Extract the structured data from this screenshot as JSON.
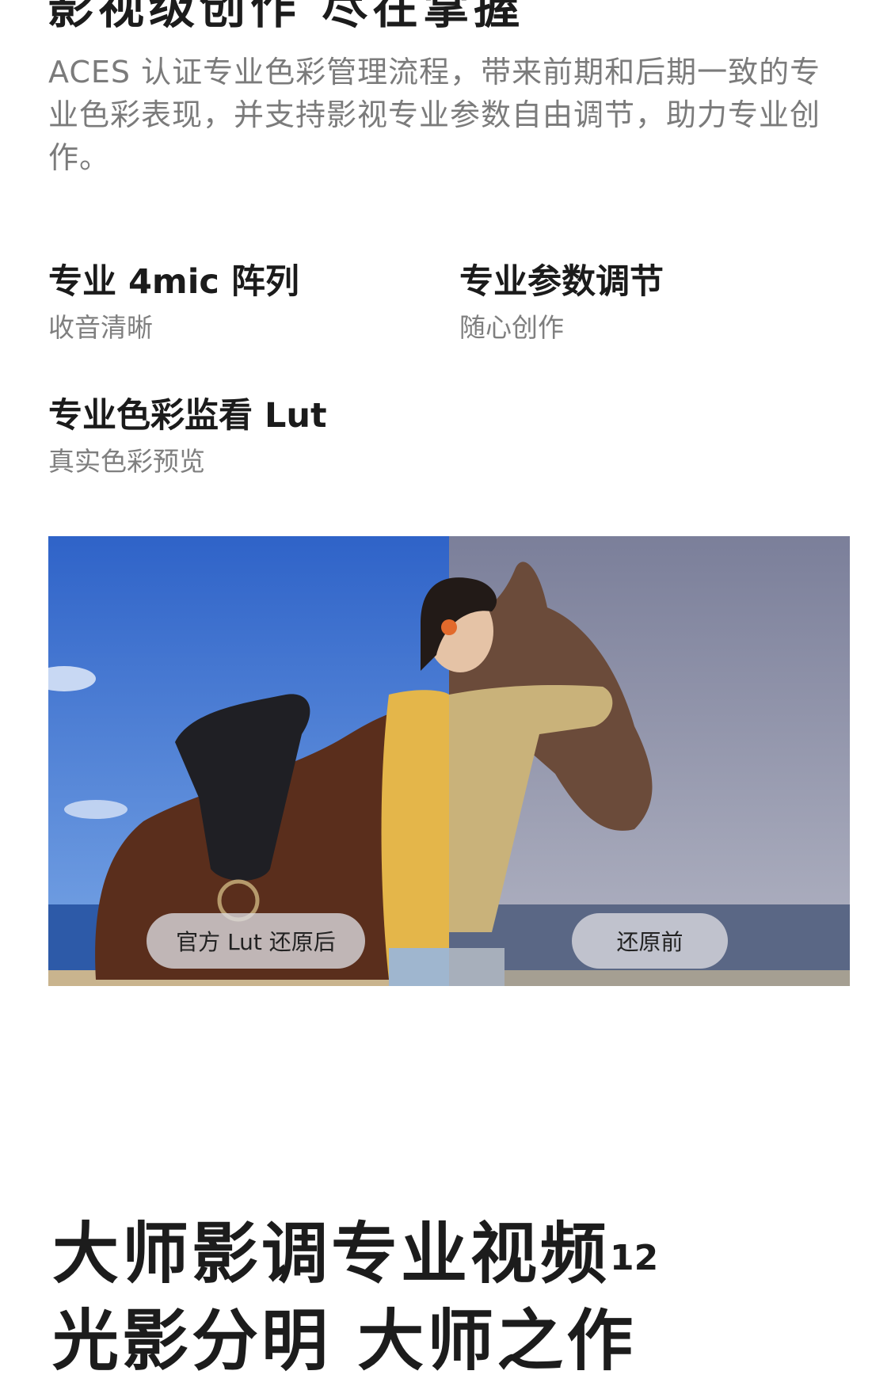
{
  "header": {
    "heading_partial": "影视级创作 尽在掌握"
  },
  "intro": {
    "text": "ACES 认证专业色彩管理流程，带来前期和后期一致的专业色彩表现，并支持影视专业参数自由调节，助力专业创作。"
  },
  "features": [
    {
      "title": "专业 4mic 阵列",
      "subtitle": "收音清晰"
    },
    {
      "title": "专业参数调节",
      "subtitle": "随心创作"
    },
    {
      "title": "专业色彩监看 Lut",
      "subtitle": "真实色彩预览"
    }
  ],
  "comparison": {
    "after_label": "官方 Lut 还原后",
    "before_label": "还原前",
    "after_sky_color": "#3a6fcf",
    "before_sky_color": "#8a8fa8"
  },
  "bottom": {
    "title_line1": "大师影调专业视频",
    "title_sup": "12",
    "title_line2": "光影分明 大师之作"
  }
}
